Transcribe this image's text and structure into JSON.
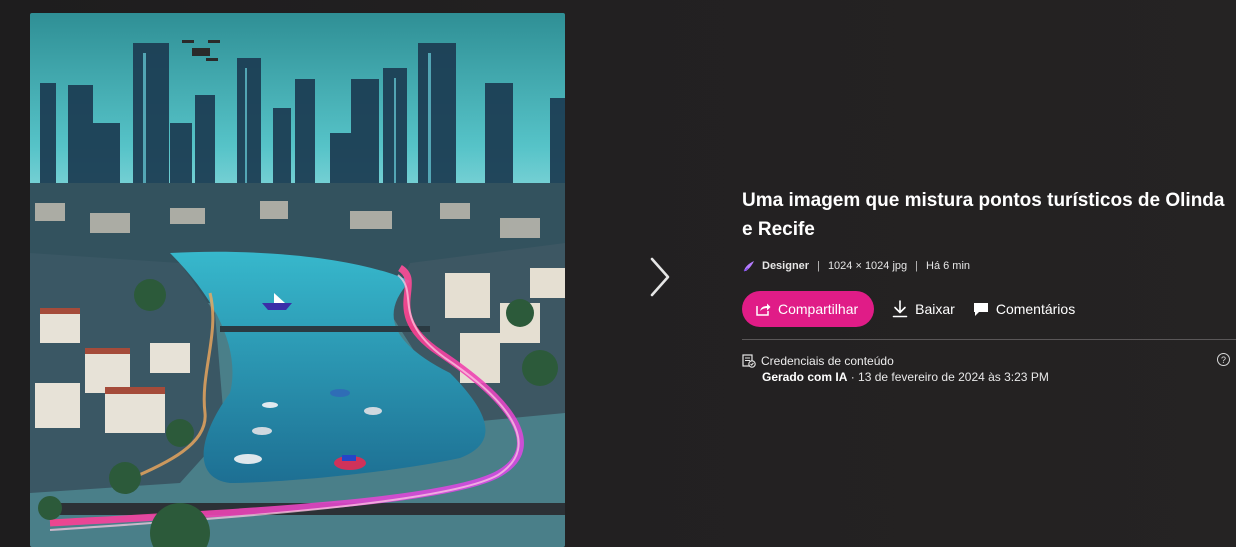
{
  "image": {
    "alt": "Uma imagem que mistura pontos turísticos de Olinda e Recife"
  },
  "navigation": {
    "next_icon": "chevron-right-icon"
  },
  "details": {
    "title": "Uma imagem que mistura pontos turísticos de Olinda e Recife",
    "app_name": "Designer",
    "dimensions": "1024 × 1024 jpg",
    "age": "Há 6 min",
    "separator": "|"
  },
  "actions": {
    "share_label": "Compartilhar",
    "download_label": "Baixar",
    "comments_label": "Comentários"
  },
  "credentials": {
    "heading": "Credenciais de conteúdo",
    "generated_label": "Gerado com IA",
    "generated_date": " · 13 de fevereiro de 2024 às 3:23 PM",
    "help_symbol": "?"
  },
  "colors": {
    "accent": "#e01c87",
    "background": "#1f1d1e",
    "divider": "#5a5758"
  }
}
